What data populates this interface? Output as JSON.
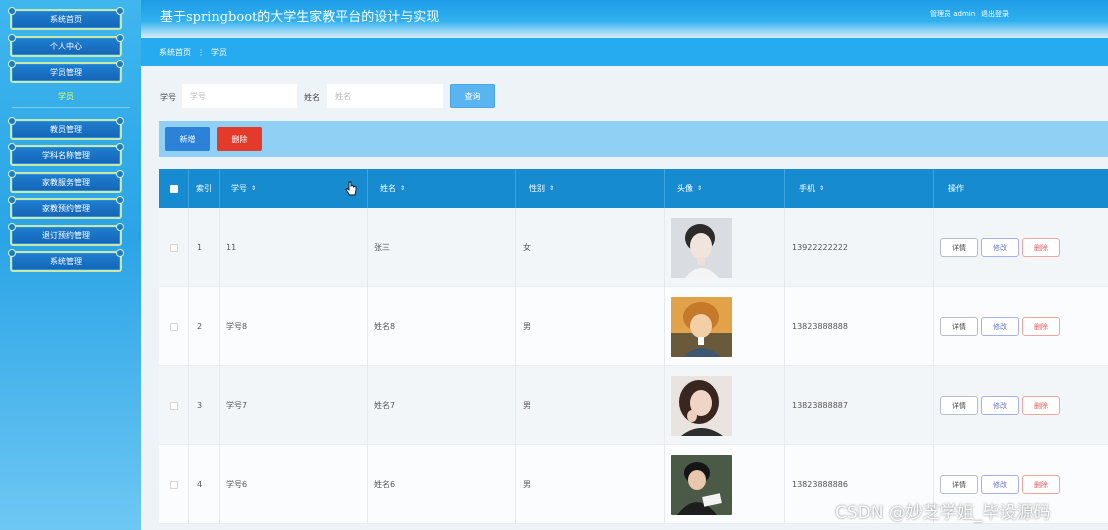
{
  "header": {
    "title": "基于springboot的大学生家教平台的设计与实现",
    "user_label": "管理员 admin",
    "logout": "退出登录"
  },
  "sidebar": {
    "items": [
      {
        "label": "系统首页"
      },
      {
        "label": "个人中心"
      },
      {
        "label": "学员管理"
      },
      {
        "label": "学员",
        "sub": true
      },
      {
        "label": "教员管理"
      },
      {
        "label": "学科名称管理"
      },
      {
        "label": "家教服务管理"
      },
      {
        "label": "家教预约管理"
      },
      {
        "label": "退订预约管理"
      },
      {
        "label": "系统管理"
      }
    ]
  },
  "breadcrumb": {
    "home": "系统首页",
    "separator": "⋮",
    "current": "学员"
  },
  "search": {
    "student_no_label": "学号",
    "student_no_placeholder": "学号",
    "name_label": "姓名",
    "name_placeholder": "姓名",
    "query_button": "查询"
  },
  "actions": {
    "add": "新增",
    "delete": "删除"
  },
  "table": {
    "columns": [
      "索引",
      "学号",
      "姓名",
      "性别",
      "头像",
      "手机",
      "操作"
    ],
    "rows": [
      {
        "index": "1",
        "student_no": "11",
        "name": "张三",
        "gender": "女",
        "phone": "13922222222"
      },
      {
        "index": "2",
        "student_no": "学号8",
        "name": "姓名8",
        "gender": "男",
        "phone": "13823888888"
      },
      {
        "index": "3",
        "student_no": "学号7",
        "name": "姓名7",
        "gender": "男",
        "phone": "13823888887"
      },
      {
        "index": "4",
        "student_no": "学号6",
        "name": "姓名6",
        "gender": "男",
        "phone": "13823888886"
      }
    ],
    "row_actions": {
      "detail": "详情",
      "edit": "修改",
      "remove": "删除"
    }
  },
  "watermark": "CSDN @妙芝学姐_毕设源码",
  "colors": {
    "accent": "#168bd0",
    "sidebar": "#2aa4e6",
    "danger": "#e33a2b",
    "primary_button": "#2b82d8"
  }
}
